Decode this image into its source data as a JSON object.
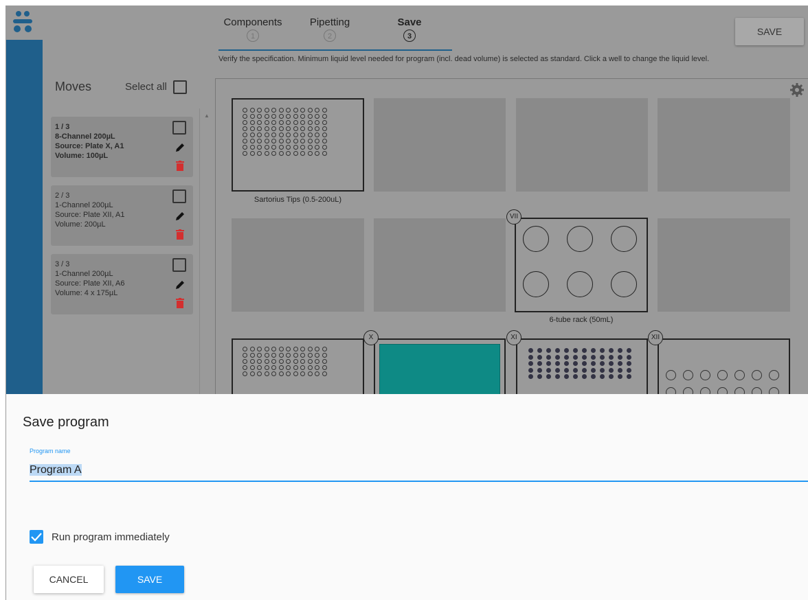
{
  "header": {
    "logo_icon": "dots-logo-icon",
    "save_label": "SAVE"
  },
  "stepper": {
    "steps": [
      {
        "label": "Components",
        "number": "1"
      },
      {
        "label": "Pipetting",
        "number": "2"
      },
      {
        "label": "Save",
        "number": "3"
      }
    ],
    "active_step": 3
  },
  "hint": "Verify the specification. Minimum liquid level needed for program (incl. dead volume) is selected as standard. Click a well to change the liquid level.",
  "moves": {
    "title": "Moves",
    "select_all_label": "Select all",
    "items": [
      {
        "index": "1 / 3",
        "pipette": "8-Channel 200µL",
        "source": "Source: Plate X, A1",
        "volume": "Volume: 100µL"
      },
      {
        "index": "2 / 3",
        "pipette": "1-Channel 200µL",
        "source": "Source: Plate XII, A1",
        "volume": "Volume: 200µL"
      },
      {
        "index": "3 / 3",
        "pipette": "1-Channel 200µL",
        "source": "Source: Plate XII, A6",
        "volume": "Volume: 4 x 175µL"
      }
    ]
  },
  "deck": {
    "labels": {
      "tips": "Sartorius Tips (0.5-200uL)",
      "tube_rack": "6-tube rack (50mL)"
    },
    "markers": {
      "m7": "VII",
      "m10": "X",
      "m11": "XI",
      "m12": "XII"
    },
    "reservoir_color": "#0e8a85"
  },
  "dialog": {
    "title": "Save program",
    "field_label": "Program name",
    "field_value": "Program A",
    "checkbox_label": "Run program immediately",
    "checkbox_checked": true,
    "cancel_label": "CANCEL",
    "save_label": "SAVE"
  },
  "colors": {
    "accent": "#2196f3",
    "sidebar": "#1f5f8b",
    "delete": "#d32f2f"
  }
}
